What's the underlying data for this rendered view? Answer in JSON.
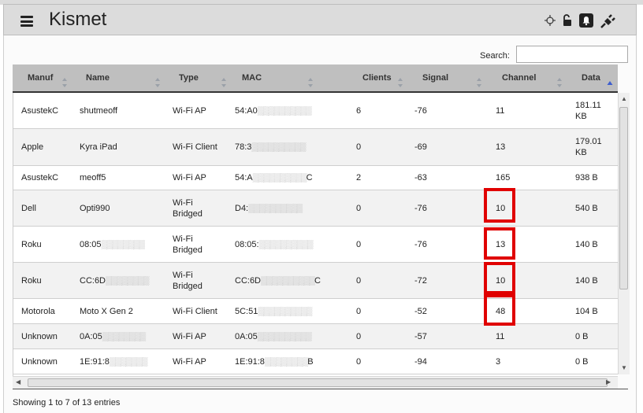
{
  "app": {
    "title": "Kismet"
  },
  "header_icons": [
    "crosshair-icon",
    "unlock-icon",
    "alert-icon",
    "plug-icon"
  ],
  "search": {
    "label": "Search:",
    "value": ""
  },
  "table": {
    "columns": [
      "Manuf",
      "Name",
      "Type",
      "MAC",
      "Clients",
      "Signal",
      "Channel",
      "Data"
    ],
    "sort_column": "Data",
    "rows": [
      {
        "manuf": "AsustekC",
        "name": "shutmeoff",
        "type": "Wi-Fi AP",
        "mac_prefix": "54:A0",
        "mac_suffix": "",
        "clients": "6",
        "signal": "-76",
        "channel": "11",
        "data": "181.11 KB"
      },
      {
        "manuf": "Apple",
        "name": "Kyra iPad",
        "type": "Wi-Fi Client",
        "mac_prefix": "78:3",
        "mac_suffix": "",
        "clients": "0",
        "signal": "-69",
        "channel": "13",
        "data": "179.01 KB"
      },
      {
        "manuf": "AsustekC",
        "name": "meoff5",
        "type": "Wi-Fi AP",
        "mac_prefix": "54:A",
        "mac_suffix": "C",
        "clients": "2",
        "signal": "-63",
        "channel": "165",
        "data": "938 B"
      },
      {
        "manuf": "Dell",
        "name": "Opti990",
        "type": "Wi-Fi Bridged",
        "mac_prefix": "D4:",
        "mac_suffix": "",
        "clients": "0",
        "signal": "-76",
        "channel": "10",
        "data": "540 B"
      },
      {
        "manuf": "Roku",
        "name": "08:05",
        "type": "Wi-Fi Bridged",
        "mac_prefix": "08:05:",
        "mac_suffix": "",
        "clients": "0",
        "signal": "-76",
        "channel": "13",
        "data": "140 B"
      },
      {
        "manuf": "Roku",
        "name": "CC:6D",
        "type": "Wi-Fi Bridged",
        "mac_prefix": "CC:6D",
        "mac_suffix": "C",
        "clients": "0",
        "signal": "-72",
        "channel": "10",
        "data": "140 B"
      },
      {
        "manuf": "Motorola",
        "name": "Moto X Gen 2",
        "type": "Wi-Fi Client",
        "mac_prefix": "5C:51",
        "mac_suffix": "",
        "clients": "0",
        "signal": "-52",
        "channel": "48",
        "data": "104 B"
      },
      {
        "manuf": "Unknown",
        "name": "0A:05",
        "type": "Wi-Fi AP",
        "mac_prefix": "0A:05",
        "mac_suffix": "",
        "clients": "0",
        "signal": "-57",
        "channel": "11",
        "data": "0 B"
      },
      {
        "manuf": "Unknown",
        "name": "1E:91:8",
        "type": "Wi-Fi AP",
        "mac_prefix": "1E:91:8",
        "mac_suffix": "B",
        "clients": "0",
        "signal": "-94",
        "channel": "3",
        "data": "0 B"
      }
    ]
  },
  "footer": {
    "info": "Showing 1 to 7 of 13 entries"
  },
  "colors": {
    "highlight": "#e00000",
    "header_bg": "#dcdcdc",
    "table_head_bg": "#bfbfbf"
  }
}
